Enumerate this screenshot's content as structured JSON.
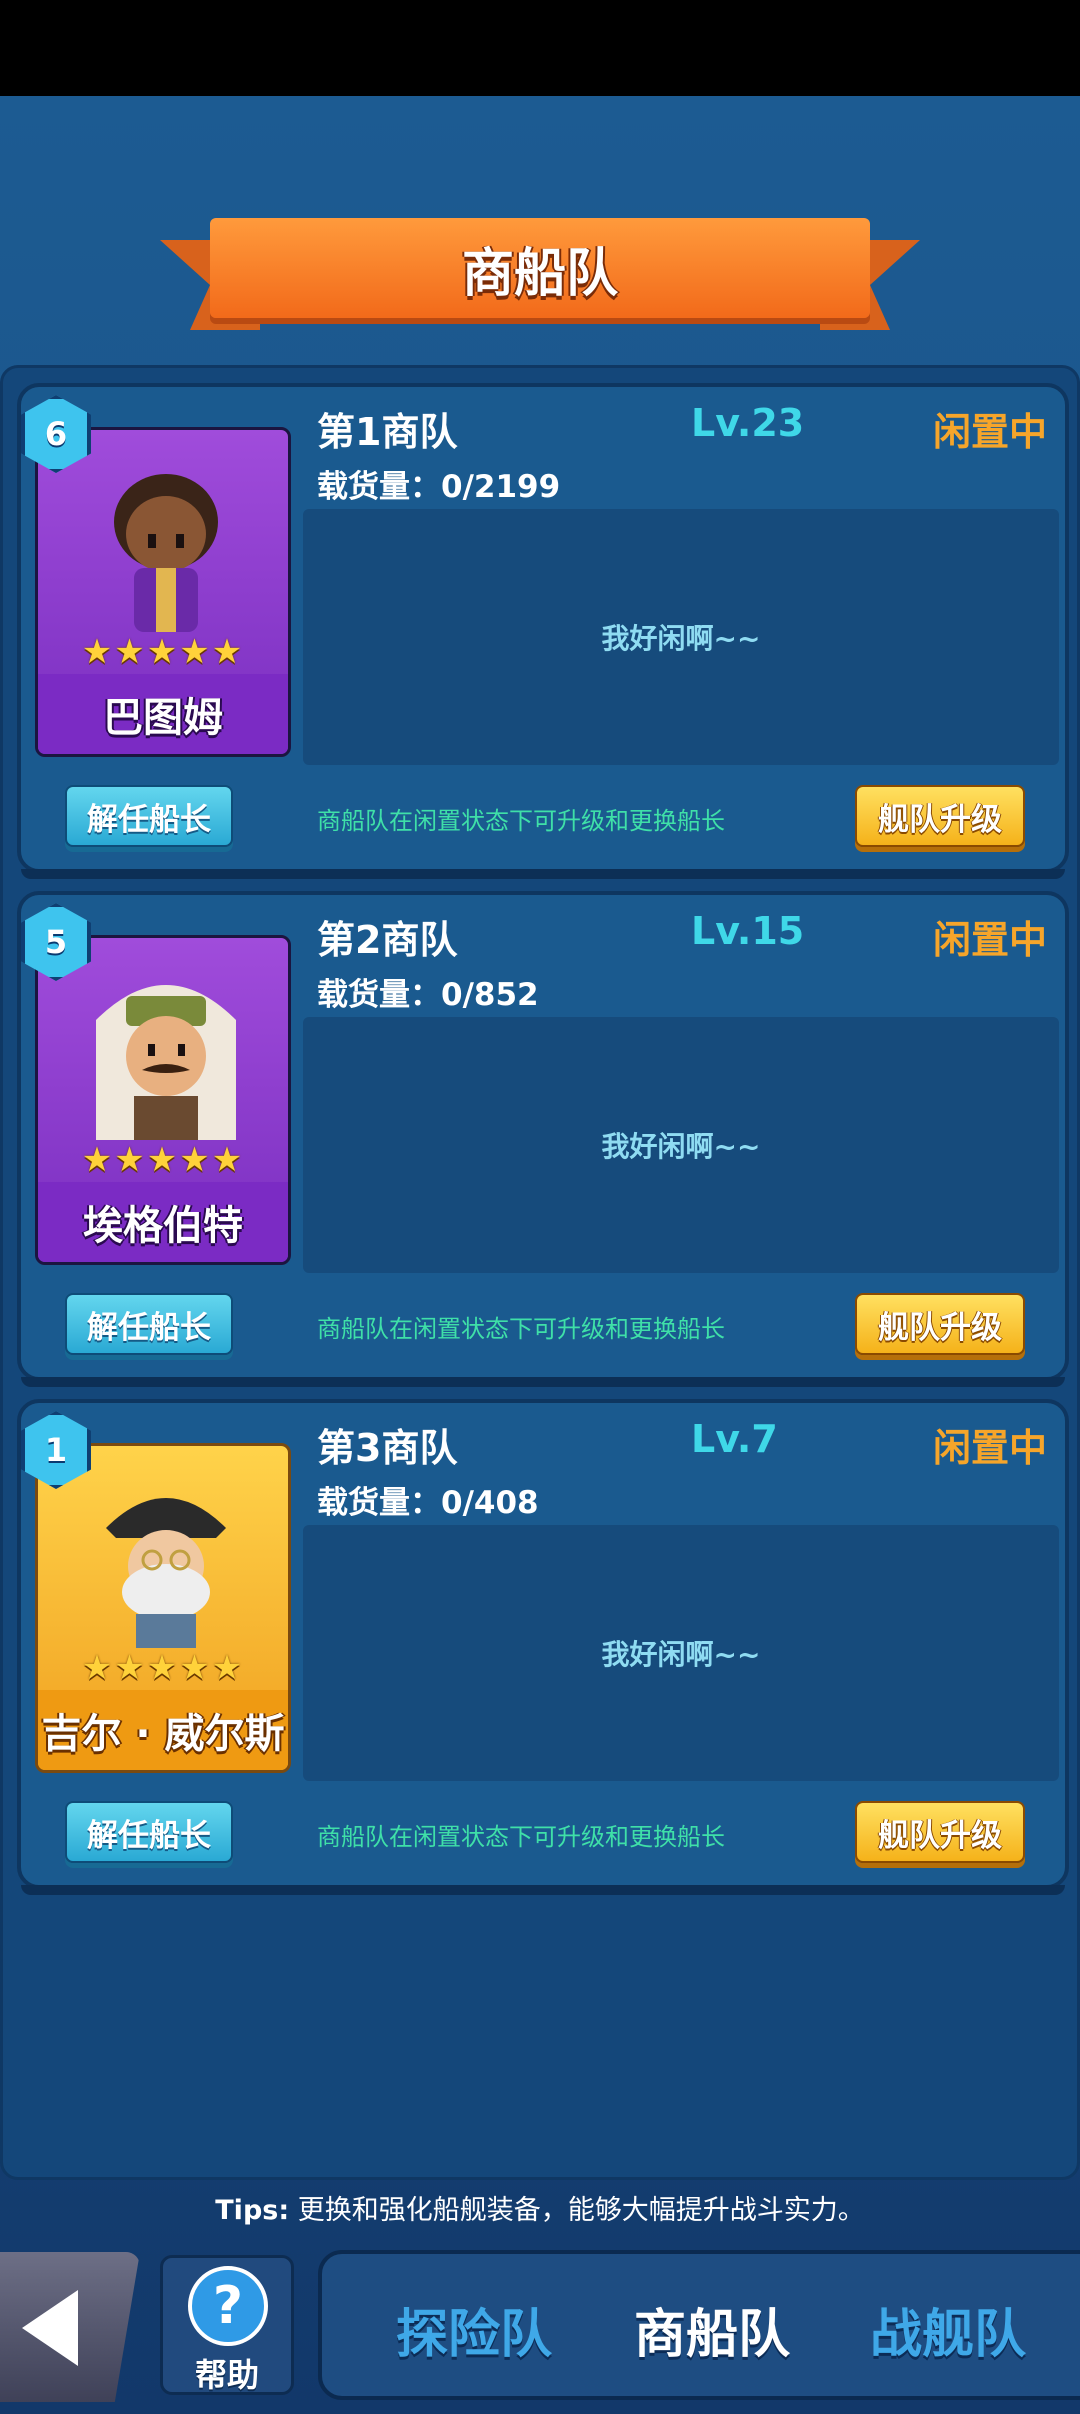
{
  "header": {
    "title": "商船队"
  },
  "fleets": [
    {
      "rank": "6",
      "captain": "巴图姆",
      "stars": "★★★★★",
      "fleet_name": "第1商队",
      "level": "Lv.23",
      "status": "闲置中",
      "cargo": "载货量：0/2199",
      "idle_message": "我好闲啊~~",
      "dismiss_label": "解任船长",
      "hint": "商船队在闲置状态下可升级和更换船长",
      "upgrade_label": "舰队升级",
      "card_color": "purple"
    },
    {
      "rank": "5",
      "captain": "埃格伯特",
      "stars": "★★★★★",
      "fleet_name": "第2商队",
      "level": "Lv.15",
      "status": "闲置中",
      "cargo": "载货量：0/852",
      "idle_message": "我好闲啊~~",
      "dismiss_label": "解任船长",
      "hint": "商船队在闲置状态下可升级和更换船长",
      "upgrade_label": "舰队升级",
      "card_color": "purple"
    },
    {
      "rank": "1",
      "captain": "吉尔 · 威尔斯",
      "stars": "★★★★★",
      "fleet_name": "第3商队",
      "level": "Lv.7",
      "status": "闲置中",
      "cargo": "载货量：0/408",
      "idle_message": "我好闲啊~~",
      "dismiss_label": "解任船长",
      "hint": "商船队在闲置状态下可升级和更换船长",
      "upgrade_label": "舰队升级",
      "card_color": "gold"
    }
  ],
  "tips": {
    "prefix": "Tips:",
    "text": "更换和强化船舰装备，能够大幅提升战斗实力。"
  },
  "nav": {
    "back_icon": "back-arrow-icon",
    "help_label": "帮助",
    "help_glyph": "?",
    "tabs": [
      {
        "label": "探险队",
        "active": false
      },
      {
        "label": "商船队",
        "active": true
      },
      {
        "label": "战舰队",
        "active": false
      }
    ]
  },
  "colors": {
    "level": "#3fd8e8",
    "status": "#f6a52a",
    "hint": "#3fe0a8",
    "upgrade_button": "#f5b21a",
    "dismiss_button": "#2aa9d4"
  }
}
